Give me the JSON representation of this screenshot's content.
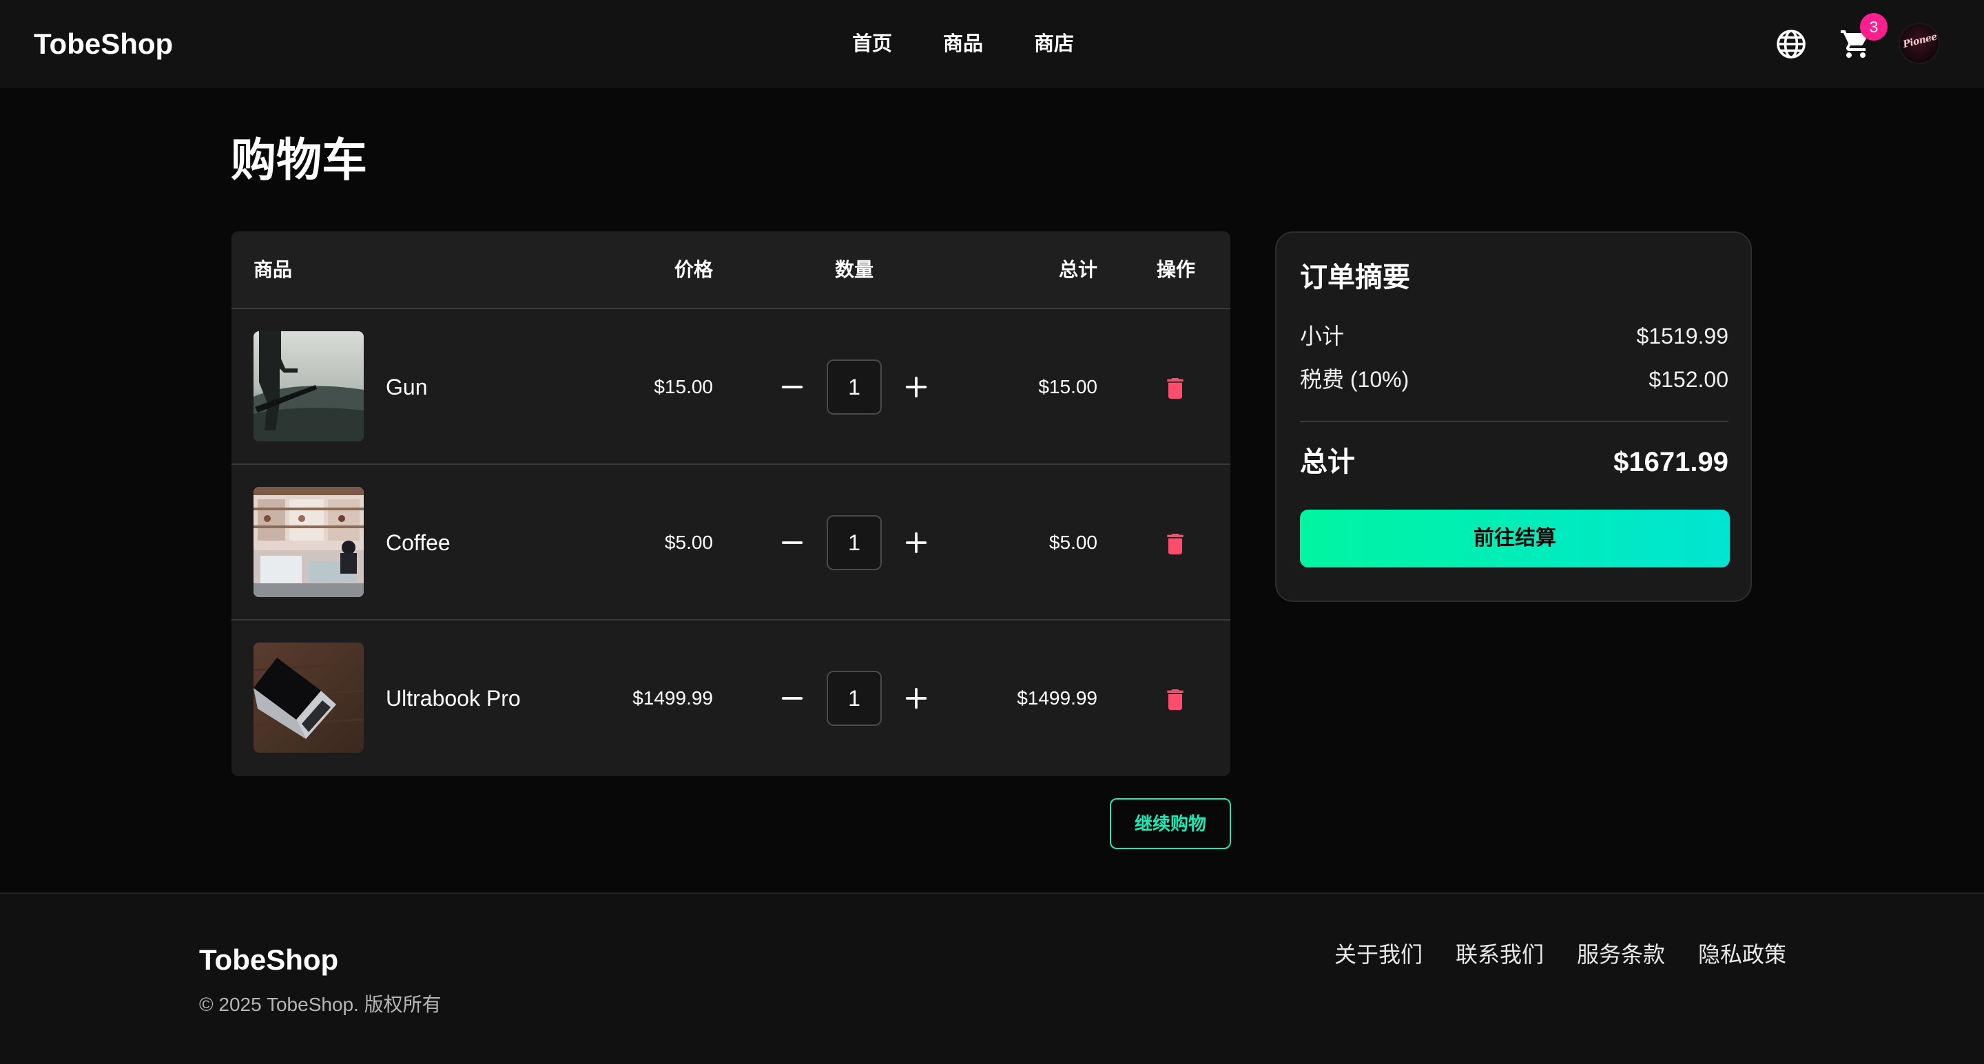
{
  "header": {
    "logo": "TobeShop",
    "nav": [
      "首页",
      "商品",
      "商店"
    ],
    "cart_count": "3",
    "avatar_text": "Pioneer",
    "icons": {
      "language": "globe-icon",
      "cart": "cart-icon"
    }
  },
  "page_title": "购物车",
  "table": {
    "headers": {
      "product": "商品",
      "price": "价格",
      "quantity": "数量",
      "total": "总计",
      "action": "操作"
    },
    "items": [
      {
        "name": "Gun",
        "price": "$15.00",
        "quantity": "1",
        "total": "$15.00"
      },
      {
        "name": "Coffee",
        "price": "$5.00",
        "quantity": "1",
        "total": "$5.00"
      },
      {
        "name": "Ultrabook Pro",
        "price": "$1499.99",
        "quantity": "1",
        "total": "$1499.99"
      }
    ]
  },
  "continue_label": "继续购物",
  "summary": {
    "title": "订单摘要",
    "subtotal_label": "小计",
    "subtotal_value": "$1519.99",
    "tax_label": "税费 (10%)",
    "tax_value": "$152.00",
    "total_label": "总计",
    "total_value": "$1671.99",
    "checkout_label": "前往结算"
  },
  "footer": {
    "brand": "TobeShop",
    "copyright": "© 2025 TobeShop. 版权所有",
    "links": [
      "关于我们",
      "联系我们",
      "服务条款",
      "隐私政策"
    ]
  },
  "colors": {
    "accent": "#1de9b6",
    "checkout_gradient_start": "#00f5a0",
    "checkout_gradient_end": "#00e5d1",
    "delete": "#ff4d6d",
    "badge": "#ff1f8e",
    "background": "#080808",
    "card": "#1c1c1c"
  }
}
